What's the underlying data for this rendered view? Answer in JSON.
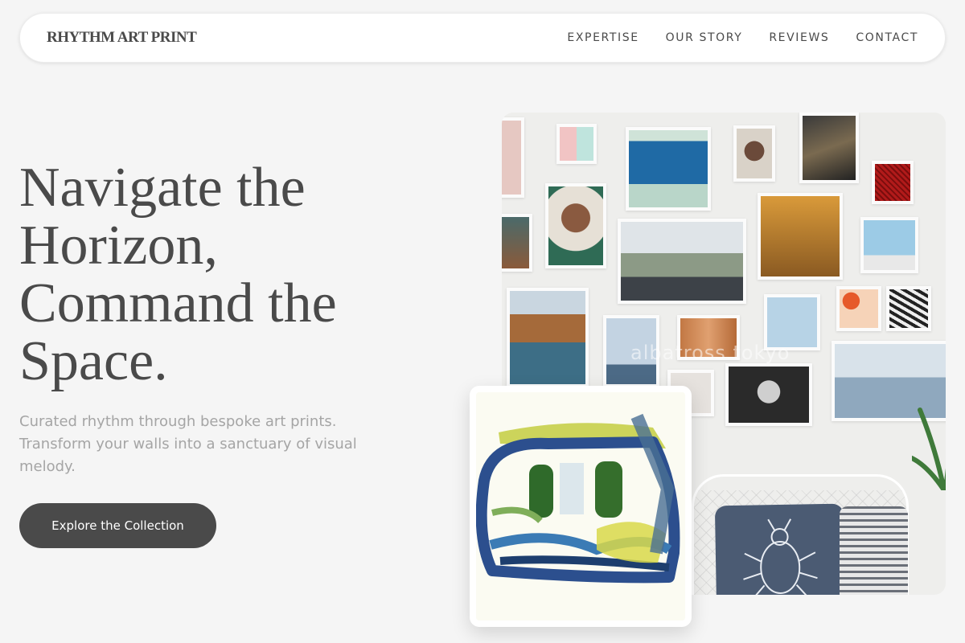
{
  "nav": {
    "logo": "RHYTHM ART PRINT",
    "links": [
      "EXPERTISE",
      "OUR STORY",
      "REVIEWS",
      "CONTACT"
    ]
  },
  "hero": {
    "title_lines": [
      "Navigate the",
      "Horizon,",
      "Command the",
      "Space."
    ],
    "subtitle": "Curated rhythm through bespoke art prints. Transform your walls into a sanctuary of visual melody.",
    "cta_label": "Explore the Collection"
  },
  "gallery": {
    "watermark": "albatross.tokyo"
  },
  "colors": {
    "background": "#f5f5f5",
    "text": "#4a4a4a",
    "muted": "#a5a5a5",
    "button": "#4a4a4a"
  }
}
